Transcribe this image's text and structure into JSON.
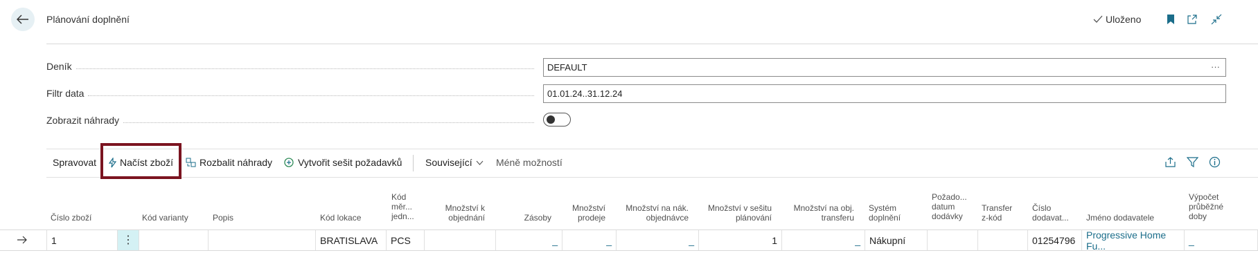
{
  "header": {
    "title": "Plánování doplnění",
    "saved_label": "Uloženo"
  },
  "fields": {
    "journal": {
      "label": "Deník",
      "value": "DEFAULT"
    },
    "date_filter": {
      "label": "Filtr data",
      "value": "01.01.24..31.12.24"
    },
    "show_substitutes": {
      "label": "Zobrazit náhrady",
      "value": false
    }
  },
  "actions": {
    "manage": "Spravovat",
    "load_items": "Načíst zboží",
    "expand_substitutes": "Rozbalit náhrady",
    "create_requisition": "Vytvořit sešit požadavků",
    "related": "Související",
    "fewer_options": "Méně možností"
  },
  "columns": {
    "item_no": "Číslo zboží",
    "variant_code": "Kód varianty",
    "description": "Popis",
    "location_code": "Kód lokace",
    "uom_code": [
      "Kód",
      "měr...",
      "jedn..."
    ],
    "qty_on_order": [
      "Množství k",
      "objednání"
    ],
    "inventory": "Zásoby",
    "qty_sales": [
      "Množství",
      "prodeje"
    ],
    "qty_purch_orders": [
      "Množství na nák.",
      "objednávce"
    ],
    "qty_worksheet": [
      "Množství v sešitu",
      "plánování"
    ],
    "qty_transfer": [
      "Množství na obj.",
      "transferu"
    ],
    "replenishment_system": [
      "Systém",
      "doplnění"
    ],
    "requested_receipt_date": [
      "Požado...",
      "datum",
      "dodávky"
    ],
    "transfer_from_code": [
      "Transfer",
      "z-kód"
    ],
    "vendor_no": [
      "Číslo",
      "dodavat..."
    ],
    "vendor_name": "Jméno dodavatele",
    "lead_time": [
      "Výpočet",
      "průběžné",
      "doby"
    ]
  },
  "row": {
    "item_no": "1",
    "location_code": "BRATISLAVA",
    "uom_code": "PCS",
    "inventory": "_",
    "qty_sales": "_",
    "qty_purch_orders": "_",
    "qty_worksheet": "1",
    "qty_transfer": "_",
    "replenishment_system": "Nákupní",
    "vendor_no": "01254796",
    "vendor_name": "Progressive Home Fu...",
    "lead_time": "_"
  },
  "icons": [
    "back-arrow-icon",
    "checkmark-icon",
    "bookmark-icon",
    "open-new-window-icon",
    "collapse-icon",
    "lightning-icon",
    "expand-substitutes-icon",
    "worksheet-icon",
    "chevron-down-icon",
    "share-icon",
    "filter-icon",
    "info-icon",
    "row-arrow-icon",
    "more-options-icon",
    "ellipsis-icon"
  ],
  "colors": {
    "accent": "#1b6d8a",
    "highlight": "#7b1420"
  }
}
